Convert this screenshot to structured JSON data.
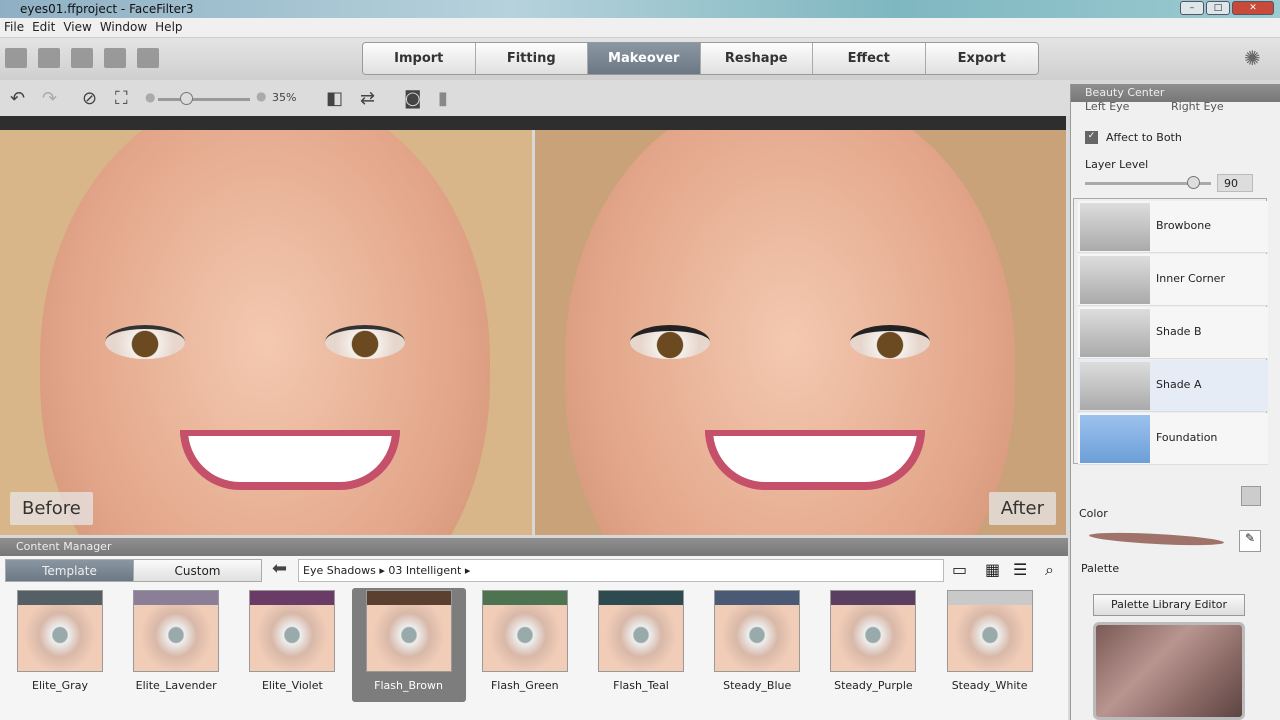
{
  "window": {
    "title": "eyes01.ffproject - FaceFilter3"
  },
  "menu": [
    "File",
    "Edit",
    "View",
    "Window",
    "Help"
  ],
  "modes": [
    {
      "label": "Import"
    },
    {
      "label": "Fitting"
    },
    {
      "label": "Makeover",
      "active": true
    },
    {
      "label": "Reshape"
    },
    {
      "label": "Effect"
    },
    {
      "label": "Export"
    }
  ],
  "toolbar": {
    "zoom": "35%",
    "zoom_level_percent": 35
  },
  "preview": {
    "before": "Before",
    "after": "After"
  },
  "beauty_center": {
    "title": "Beauty Center",
    "left_eye": "Left Eye",
    "right_eye": "Right Eye",
    "affect_both": "Affect to Both",
    "affect_both_checked": true,
    "layer_level_label": "Layer Level",
    "layer_level": "90",
    "layers": [
      "Browbone",
      "Inner Corner",
      "Shade B",
      "Shade A",
      "Foundation"
    ],
    "color_label": "Color",
    "color": "#a0736a",
    "palette_label": "Palette",
    "palette_editor": "Palette Library Editor"
  },
  "content_manager": {
    "title": "Content Manager",
    "tabs": [
      "Template",
      "Custom"
    ],
    "breadcrumb": [
      "Eye Shadows",
      "03 Intelligent"
    ],
    "items": [
      {
        "name": "Elite_Gray",
        "color": "#556066"
      },
      {
        "name": "Elite_Lavender",
        "color": "#8a7f96"
      },
      {
        "name": "Elite_Violet",
        "color": "#6a3b66"
      },
      {
        "name": "Flash_Brown",
        "color": "#5b4030",
        "selected": true
      },
      {
        "name": "Flash_Green",
        "color": "#4e7350"
      },
      {
        "name": "Flash_Teal",
        "color": "#2d4a50"
      },
      {
        "name": "Steady_Blue",
        "color": "#4a5a74"
      },
      {
        "name": "Steady_Purple",
        "color": "#5a4060"
      },
      {
        "name": "Steady_White",
        "color": "#c9c9c9"
      }
    ]
  }
}
